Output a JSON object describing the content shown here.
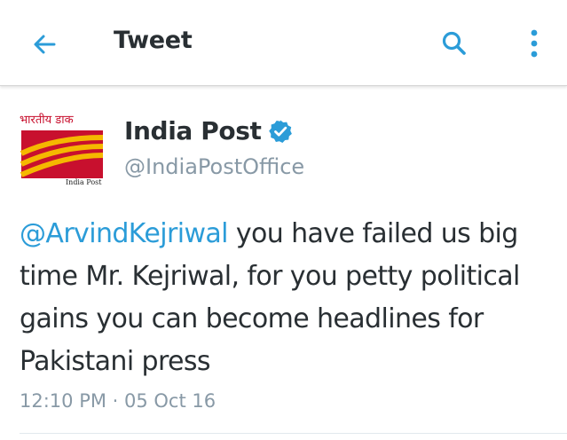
{
  "header": {
    "title": "Tweet",
    "back_icon": "arrow-left-icon",
    "search_icon": "search-icon",
    "menu_icon": "more-vertical-icon"
  },
  "tweet": {
    "avatar": {
      "logo_text_hindi": "भारतीय डाक",
      "logo_caption": "India Post"
    },
    "display_name": "India Post",
    "verified_icon": "verified-badge-icon",
    "handle": "@IndiaPostOffice",
    "mention": "@ArvindKejriwal",
    "text": " you have failed us big time Mr. Kejriwal, for you petty political gains you can become headlines for Pakistani press",
    "timestamp": "12:10 PM · 05 Oct 16"
  },
  "colors": {
    "accent": "#2b9cd8",
    "text_primary": "#292f33",
    "text_secondary": "#8899a6",
    "brand_red": "#c8102e",
    "brand_yellow": "#f5b800"
  }
}
